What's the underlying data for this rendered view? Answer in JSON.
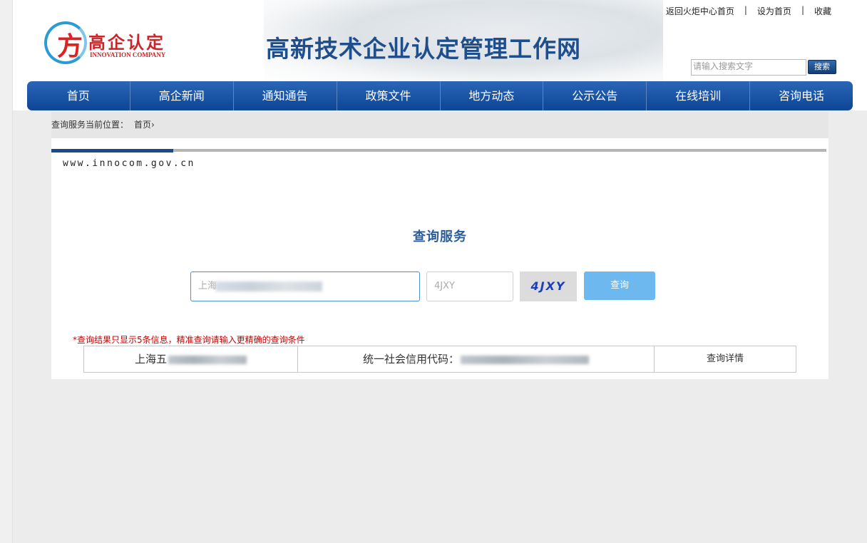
{
  "top_links": [
    "返回火炬中心首页",
    "设为首页",
    "收藏"
  ],
  "logo": {
    "cn": "高企认定",
    "en": "INNOVATION COMPANY",
    "mark": "方"
  },
  "site_title": "高新技术企业认定管理工作网",
  "search": {
    "placeholder": "请输入搜索文字",
    "button": "搜索"
  },
  "nav": [
    "首页",
    "高企新闻",
    "通知通告",
    "政策文件",
    "地方动态",
    "公示公告",
    "在线培训",
    "咨询电话"
  ],
  "breadcrumb": {
    "label": "查询服务当前位置：",
    "home": "首页",
    "arrow": "›"
  },
  "url_text": "www.innocom.gov.cn",
  "query": {
    "title": "查询服务",
    "company_value": "上海",
    "code_placeholder": "4JXY",
    "captcha": "4JXY",
    "button": "查询"
  },
  "notice": "*查询结果只显示5条信息，精准查询请输入更精确的查询条件",
  "results": [
    {
      "name": "上海五",
      "code_label": "统一社会信用代码：",
      "detail": "查询详情"
    }
  ]
}
